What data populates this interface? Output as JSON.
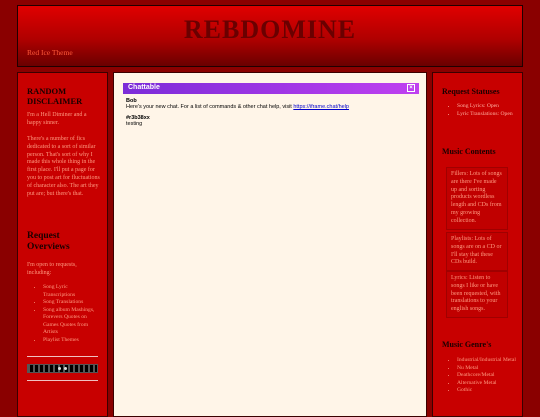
{
  "site": {
    "title": "REBDOMINE",
    "tagline": "Red Ice Theme"
  },
  "left_sidebar": {
    "disclaimer_title": "RANDOM DISCLAIMER",
    "disclaimer_p1": "I'm a Hell Diminer and a happy sinner.",
    "disclaimer_p2": "There's a number of fics dedicated to a sort of similar person. That's sort of why I made this whole thing in the first place. I'll put a page for you to post art for fluctuations of character also. The art they put are; but there's that.",
    "overviews_title": "Request Overviews",
    "overviews_intro": "I'm open to requests, including:",
    "overviews_items": [
      "Song Lyric Transcriptions",
      "Song Translations",
      "Song album Mashings, Forevers Quotes on Games Quotes from Artists",
      "Playlist Themes"
    ]
  },
  "chat": {
    "header": "Chattable",
    "close": "×",
    "messages": [
      {
        "name": "Bob",
        "text": "Here's your new chat. For a list of commands & other chat help, visit ",
        "link": "https://iframe.chat/help"
      },
      {
        "name": "#r3b38xx",
        "text": "testing"
      }
    ]
  },
  "right_sidebar": {
    "statuses_title": "Request Statuses",
    "statuses_items": [
      "Song Lyrics: Open",
      "Lyric Translations: Open"
    ],
    "contents_title": "Music Contents",
    "contents_p1": "Fillers: Lots of songs are there I've made up and sorting products wordless length and CDs from my growing collection.",
    "contents_p2": "Playlists: Lots of songs are on a CD or I'll stay that these CDs build.",
    "contents_p3": "Lyrics: Listen to songs I like or have been requested, with translations to your english songs.",
    "genres_title": "Music Genre's",
    "genres_items": [
      "Industrial/Industrial Metal",
      "Nu Metal",
      "Deathcore/Metal",
      "Alternative Metal",
      "Gothic"
    ]
  }
}
